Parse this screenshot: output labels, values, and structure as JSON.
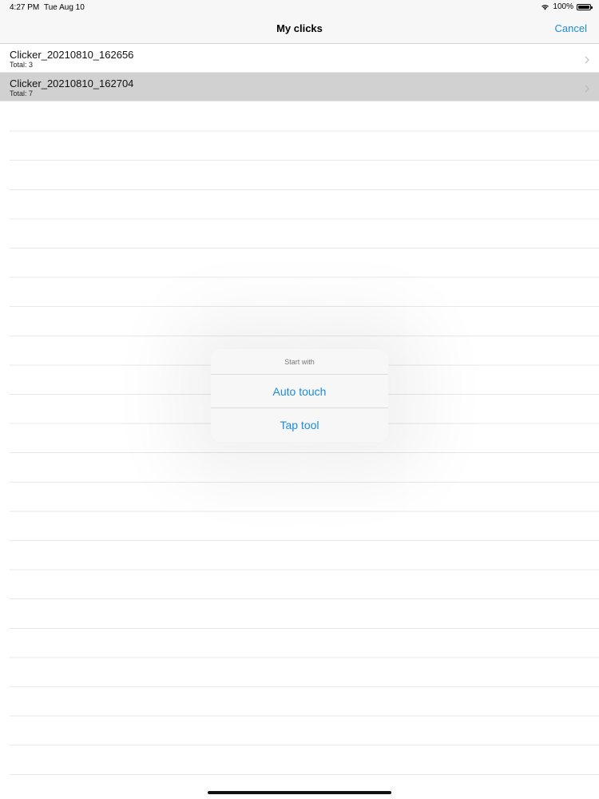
{
  "status_bar": {
    "time": "4:27 PM",
    "date": "Tue Aug 10",
    "battery_text": "100%",
    "wifi_icon": "wifi-icon",
    "battery_icon": "battery-icon"
  },
  "nav": {
    "title": "My clicks",
    "cancel_label": "Cancel"
  },
  "list": {
    "items": [
      {
        "title": "Clicker_20210810_162656",
        "subtitle": "Total: 3",
        "selected": false
      },
      {
        "title": "Clicker_20210810_162704",
        "subtitle": "Total: 7",
        "selected": true
      }
    ],
    "chevron_icon": "chevron-right-icon"
  },
  "alert": {
    "title": "Start with",
    "actions": [
      {
        "label": "Auto touch"
      },
      {
        "label": "Tap tool"
      }
    ]
  },
  "colors": {
    "accent": "#1a8ddb",
    "selected_row": "#d1d1d1",
    "bar_background": "#f7f7f7"
  }
}
